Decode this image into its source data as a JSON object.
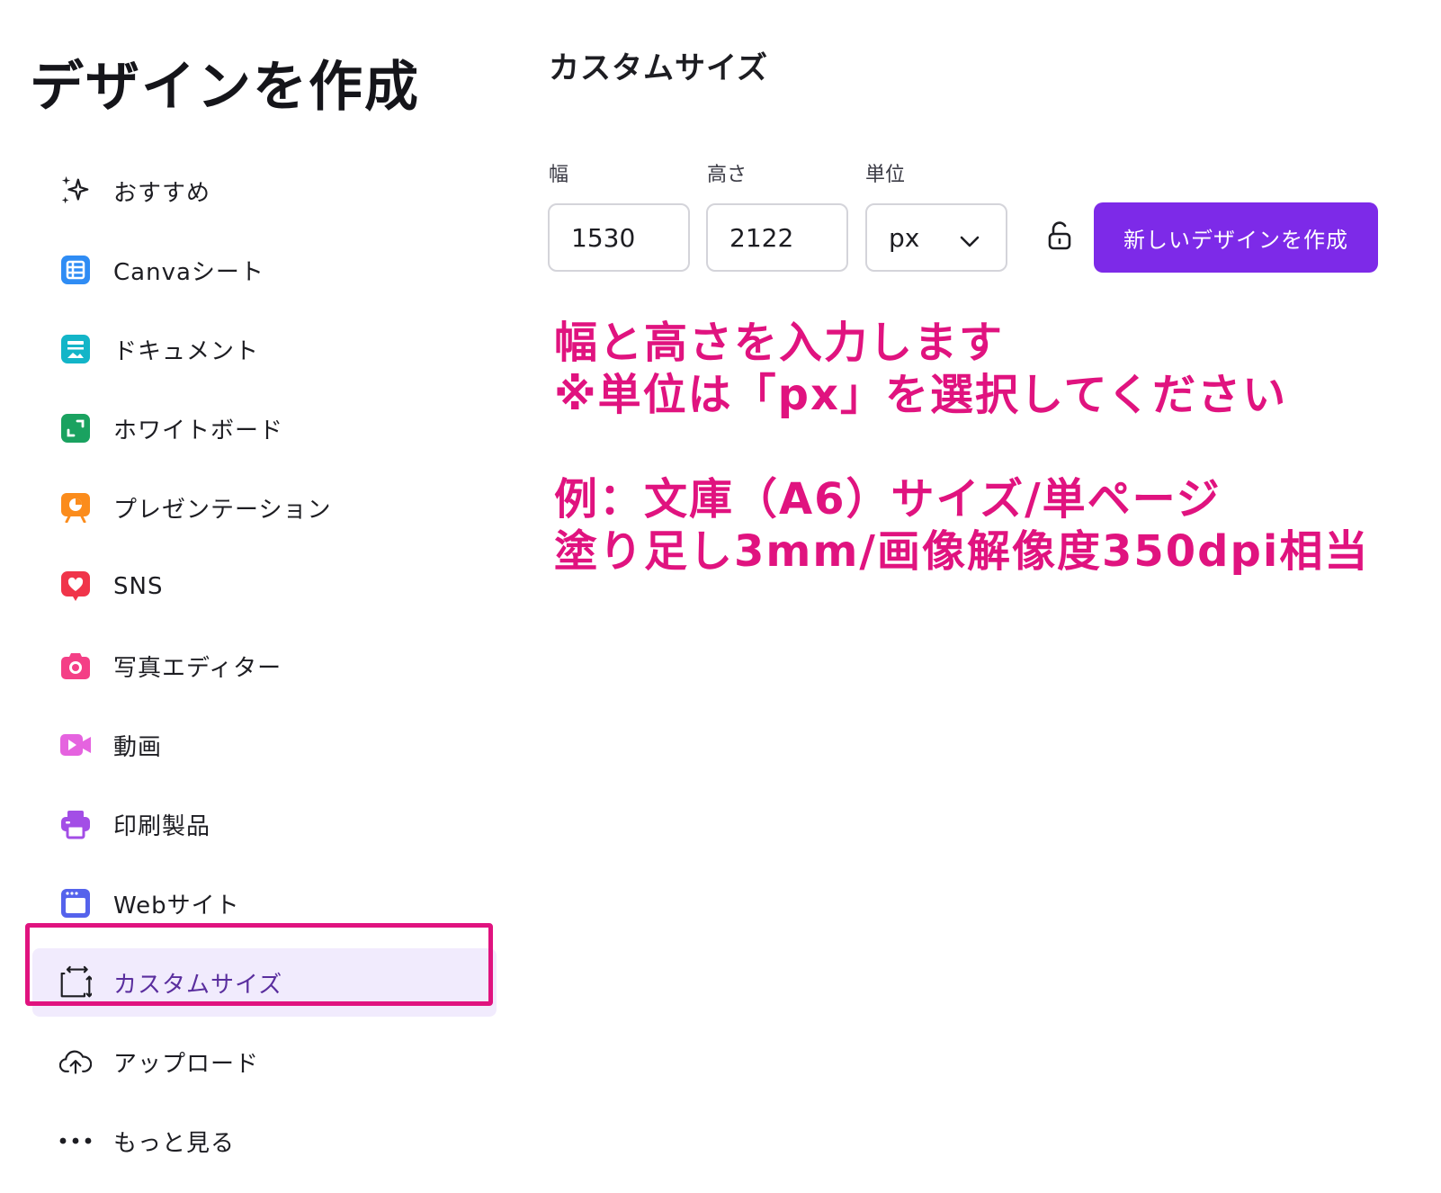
{
  "page_title": "デザインを作成",
  "sidebar": {
    "items": [
      {
        "label": "おすすめ",
        "icon": "sparkle-icon"
      },
      {
        "label": "Canvaシート",
        "icon": "sheet-icon",
        "color": "#2f8cf4"
      },
      {
        "label": "ドキュメント",
        "icon": "document-icon",
        "color": "#13b5c8"
      },
      {
        "label": "ホワイトボード",
        "icon": "whiteboard-icon",
        "color": "#1aa260"
      },
      {
        "label": "プレゼンテーション",
        "icon": "presentation-icon",
        "color": "#fb8c1c"
      },
      {
        "label": "SNS",
        "icon": "heart-icon",
        "color": "#f0344a"
      },
      {
        "label": "写真エディター",
        "icon": "camera-icon",
        "color": "#f43f86"
      },
      {
        "label": "動画",
        "icon": "video-icon",
        "color": "#e563df"
      },
      {
        "label": "印刷製品",
        "icon": "printer-icon",
        "color": "#a34ee6"
      },
      {
        "label": "Webサイト",
        "icon": "website-icon",
        "color": "#5563ec"
      },
      {
        "label": "カスタムサイズ",
        "icon": "custom-size-icon",
        "active": true
      },
      {
        "label": "アップロード",
        "icon": "cloud-upload-icon"
      },
      {
        "label": "もっと見る",
        "icon": "more-icon"
      }
    ]
  },
  "main": {
    "title": "カスタムサイズ",
    "width": {
      "label": "幅",
      "value": "1530"
    },
    "height": {
      "label": "高さ",
      "value": "2122"
    },
    "unit": {
      "label": "単位",
      "value": "px"
    },
    "lock_icon": "lock-icon",
    "create_button": "新しいデザインを作成"
  },
  "annotation": {
    "line1": "幅と高さを入力します",
    "line2": "※単位は「px」を選択してください",
    "line3": "例：文庫（A6）サイズ/単ページ",
    "line4": "塗り足し3mm/画像解像度350dpi相当",
    "color": "#e0137f"
  },
  "colors": {
    "accent": "#7d2ae8",
    "active_bg": "#f1ebfd",
    "highlight": "#e0137f"
  }
}
